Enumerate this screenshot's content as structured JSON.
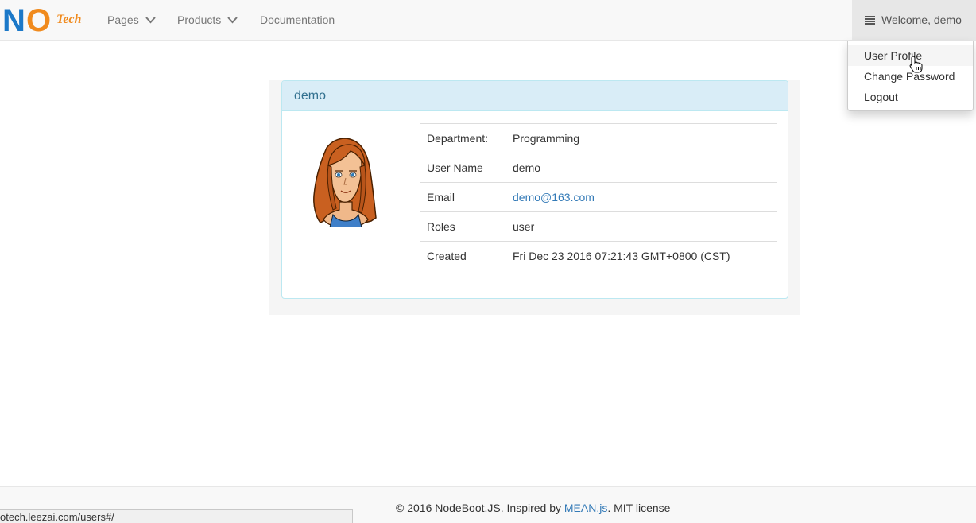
{
  "brand": {
    "letters_big_1": "N",
    "letters_big_2": "O",
    "letters_small": "Tech"
  },
  "nav": {
    "items": [
      {
        "label": "Pages",
        "icon": "chevron-down-icon"
      },
      {
        "label": "Products",
        "icon": "chevron-down-icon"
      },
      {
        "label": "Documentation"
      }
    ],
    "welcome_prefix": "Welcome,",
    "welcome_user": "demo",
    "menu_icon": "bars-icon"
  },
  "dropdown": {
    "items": [
      {
        "label": "User Profile"
      },
      {
        "label": "Change Password"
      },
      {
        "label": "Logout"
      }
    ]
  },
  "panel": {
    "title": "demo",
    "avatar_icon": "girl-avatar-icon",
    "rows": [
      {
        "key": "Department:",
        "value": "Programming"
      },
      {
        "key": "User Name",
        "value": "demo"
      },
      {
        "key": "Email",
        "value": "demo@163.com"
      },
      {
        "key": "Roles",
        "value": "user"
      },
      {
        "key": "Created",
        "value": "Fri Dec 23 2016 07:21:43 GMT+0800 (CST)"
      }
    ]
  },
  "footer": {
    "prefix": "© 2016 NodeBoot.JS. Inspired by",
    "link": "MEAN.js",
    "suffix": ". MIT license"
  },
  "status_url": "otech.leezai.com/users#/",
  "colors": {
    "accent": "#337ab7",
    "brand_blue": "#1b78c8",
    "brand_orange": "#f08a1d",
    "panel_heading": "#d9edf7"
  }
}
